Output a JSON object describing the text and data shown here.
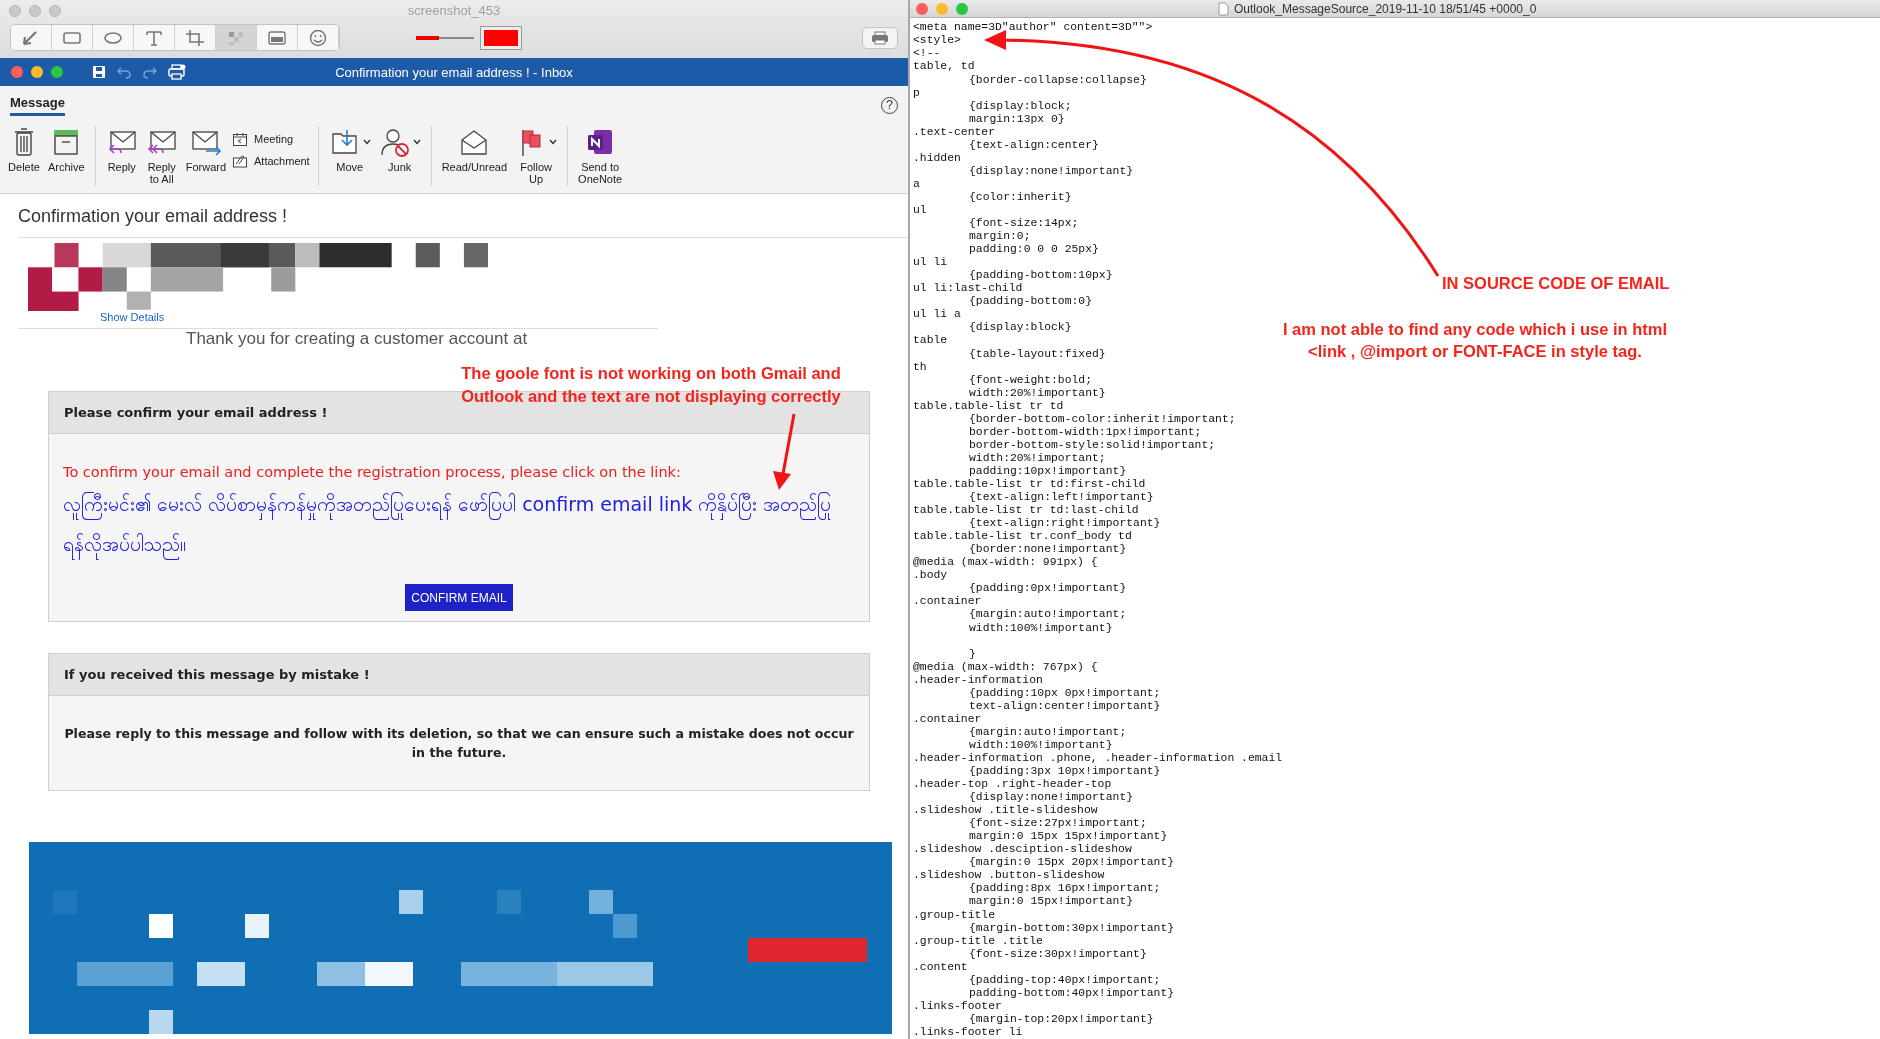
{
  "screenshot_app": {
    "title": "screenshot_453",
    "tools": [
      {
        "selected": false
      },
      {
        "selected": false
      },
      {
        "selected": false
      },
      {
        "selected": false
      },
      {
        "selected": false
      },
      {
        "selected": true
      },
      {
        "selected": false
      },
      {
        "selected": false
      }
    ],
    "line_width": {
      "level": 0.4
    }
  },
  "mail_window": {
    "title": "Confirmation your email address ! - Inbox"
  },
  "ribbon": {
    "tab": {
      "label": "Message",
      "selected": true
    },
    "help": "?",
    "groups": [
      {
        "buttons": [
          {
            "label": "Delete",
            "kind": "large",
            "has_menu": false
          },
          {
            "label": "Archive",
            "kind": "large",
            "has_menu": false
          }
        ]
      },
      {
        "buttons": [
          {
            "label": "Reply",
            "kind": "large",
            "has_menu": false
          },
          {
            "label": "Reply\nto All",
            "kind": "large",
            "has_menu": false
          },
          {
            "label": "Forward",
            "kind": "large",
            "has_menu": false
          },
          {
            "label": "Meeting",
            "kind": "small"
          },
          {
            "label": "Attachment",
            "kind": "small"
          }
        ]
      },
      {
        "buttons": [
          {
            "label": "Move",
            "kind": "large",
            "has_menu": true
          },
          {
            "label": "Junk",
            "kind": "large",
            "has_menu": true
          }
        ]
      },
      {
        "buttons": [
          {
            "label": "Read/Unread",
            "kind": "large",
            "has_menu": false
          },
          {
            "label": "Follow\nUp",
            "kind": "large",
            "has_menu": true
          }
        ]
      },
      {
        "buttons": [
          {
            "label": "Send to\nOneNote",
            "kind": "large",
            "has_menu": false
          }
        ]
      }
    ]
  },
  "email": {
    "subject": "Confirmation your email address !",
    "show_details": "Show Details",
    "intro": "Thank you for creating a customer account at",
    "confirm_box": {
      "title": "Please confirm your email address !",
      "instruction": "To confirm your email and complete the registration process, please click on the link:",
      "burmese_text": "လူကြီးမင်း၏ မေးလ် လိပ်စာမှန်ကန်မှုကိုအတည်ပြုပေးရန် ဖော်ပြပါ confirm email link ကိုနှိပ်ပြီး အတည်ပြုရန်လိုအပ်ပါသည်။",
      "button": "CONFIRM EMAIL"
    },
    "mistake_box": {
      "title": "If you received this message by mistake !",
      "body": "Please reply to this message and follow with its deletion, so that we can ensure such a mistake does not occur in the future."
    }
  },
  "annotations": {
    "font_issue": "The goole font is not working on both Gmail and\nOutlook and the text are not displaying correctly",
    "source_heading": "IN SOURCE CODE OF EMAIL",
    "source_note": "I am not able to find any code which i use in html\n<link , @import or FONT-FACE in style tag."
  },
  "source_window": {
    "title": "Outlook_MessageSource_2019-11-10 18/51/45 +0000_0",
    "lines": [
      {
        "kind": "sel",
        "text": "<meta name=3D\"author\" content=3D\"\">"
      },
      {
        "kind": "sel",
        "text": "<style>"
      },
      {
        "kind": "sel",
        "text": "<!--"
      },
      {
        "kind": "sel",
        "text": "table, td"
      },
      {
        "kind": "rule",
        "text": "{border-collapse:collapse}"
      },
      {
        "kind": "sel",
        "text": "p"
      },
      {
        "kind": "rule",
        "text": "{display:block;"
      },
      {
        "kind": "rule",
        "text": "margin:13px 0}"
      },
      {
        "kind": "sel",
        "text": ".text-center"
      },
      {
        "kind": "rule",
        "text": "{text-align:center}"
      },
      {
        "kind": "sel",
        "text": ".hidden"
      },
      {
        "kind": "rule",
        "text": "{display:none!important}"
      },
      {
        "kind": "sel",
        "text": "a"
      },
      {
        "kind": "rule",
        "text": "{color:inherit}"
      },
      {
        "kind": "sel",
        "text": "ul"
      },
      {
        "kind": "rule",
        "text": "{font-size:14px;"
      },
      {
        "kind": "rule",
        "text": "margin:0;"
      },
      {
        "kind": "rule",
        "text": "padding:0 0 0 25px}"
      },
      {
        "kind": "sel",
        "text": "ul li"
      },
      {
        "kind": "rule",
        "text": "{padding-bottom:10px}"
      },
      {
        "kind": "sel",
        "text": "ul li:last-child"
      },
      {
        "kind": "rule",
        "text": "{padding-bottom:0}"
      },
      {
        "kind": "sel",
        "text": "ul li a"
      },
      {
        "kind": "rule",
        "text": "{display:block}"
      },
      {
        "kind": "sel",
        "text": "table"
      },
      {
        "kind": "rule",
        "text": "{table-layout:fixed}"
      },
      {
        "kind": "sel",
        "text": "th"
      },
      {
        "kind": "rule",
        "text": "{font-weight:bold;"
      },
      {
        "kind": "rule",
        "text": "width:20%!important}"
      },
      {
        "kind": "sel",
        "text": "table.table-list tr td"
      },
      {
        "kind": "rule",
        "text": "{border-bottom-color:inherit!important;"
      },
      {
        "kind": "rule",
        "text": "border-bottom-width:1px!important;"
      },
      {
        "kind": "rule",
        "text": "border-bottom-style:solid!important;"
      },
      {
        "kind": "rule",
        "text": "width:20%!important;"
      },
      {
        "kind": "rule",
        "text": "padding:10px!important}"
      },
      {
        "kind": "sel",
        "text": "table.table-list tr td:first-child"
      },
      {
        "kind": "rule",
        "text": "{text-align:left!important}"
      },
      {
        "kind": "sel",
        "text": "table.table-list tr td:last-child"
      },
      {
        "kind": "rule",
        "text": "{text-align:right!important}"
      },
      {
        "kind": "sel",
        "text": "table.table-list tr.conf_body td"
      },
      {
        "kind": "rule",
        "text": "{border:none!important}"
      },
      {
        "kind": "sel",
        "text": "@media (max-width: 991px) {"
      },
      {
        "kind": "sel",
        "text": ".body"
      },
      {
        "kind": "rule",
        "text": "{padding:0px!important}"
      },
      {
        "kind": "sel",
        "text": ".container"
      },
      {
        "kind": "rule",
        "text": "{margin:auto!important;"
      },
      {
        "kind": "rule",
        "text": "width:100%!important}"
      },
      {
        "kind": "blank"
      },
      {
        "kind": "rule",
        "text": "}"
      },
      {
        "kind": "sel",
        "text": "@media (max-width: 767px) {"
      },
      {
        "kind": "sel",
        "text": ".header-information"
      },
      {
        "kind": "rule",
        "text": "{padding:10px 0px!important;"
      },
      {
        "kind": "rule",
        "text": "text-align:center!important}"
      },
      {
        "kind": "sel",
        "text": ".container"
      },
      {
        "kind": "rule",
        "text": "{margin:auto!important;"
      },
      {
        "kind": "rule",
        "text": "width:100%!important}"
      },
      {
        "kind": "sel",
        "text": ".header-information .phone, .header-information .email"
      },
      {
        "kind": "rule",
        "text": "{padding:3px 10px!important}"
      },
      {
        "kind": "sel",
        "text": ".header-top .right-header-top"
      },
      {
        "kind": "rule",
        "text": "{display:none!important}"
      },
      {
        "kind": "sel",
        "text": ".slideshow .title-slideshow"
      },
      {
        "kind": "rule",
        "text": "{font-size:27px!important;"
      },
      {
        "kind": "rule",
        "text": "margin:0 15px 15px!important}"
      },
      {
        "kind": "sel",
        "text": ".slideshow .desciption-slideshow"
      },
      {
        "kind": "rule",
        "text": "{margin:0 15px 20px!important}"
      },
      {
        "kind": "sel",
        "text": ".slideshow .button-slideshow"
      },
      {
        "kind": "rule",
        "text": "{padding:8px 16px!important;"
      },
      {
        "kind": "rule",
        "text": "margin:0 15px!important}"
      },
      {
        "kind": "sel",
        "text": ".group-title"
      },
      {
        "kind": "rule",
        "text": "{margin-bottom:30px!important}"
      },
      {
        "kind": "sel",
        "text": ".group-title .title"
      },
      {
        "kind": "rule",
        "text": "{font-size:30px!important}"
      },
      {
        "kind": "sel",
        "text": ".content"
      },
      {
        "kind": "rule",
        "text": "{padding-top:40px!important;"
      },
      {
        "kind": "rule",
        "text": "padding-bottom:40px!important}"
      },
      {
        "kind": "sel",
        "text": ".links-footer"
      },
      {
        "kind": "rule",
        "text": "{margin-top:20px!important}"
      },
      {
        "kind": "sel",
        "text": ".links-footer li"
      }
    ]
  }
}
